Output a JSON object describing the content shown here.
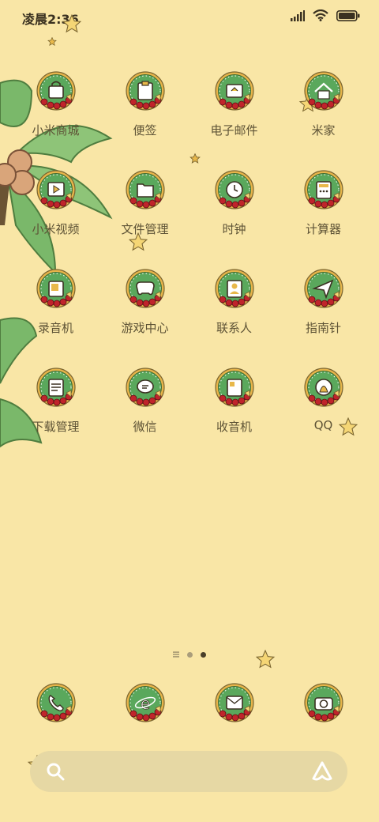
{
  "status_bar": {
    "time": "凌晨2:36",
    "signal": "signal-icon",
    "wifi": "wifi-icon",
    "battery": "battery-icon"
  },
  "apps": [
    [
      {
        "label": "小米商城",
        "icon": "shop-bag-icon"
      },
      {
        "label": "便签",
        "icon": "note-icon"
      },
      {
        "label": "电子邮件",
        "icon": "email-icon"
      },
      {
        "label": "米家",
        "icon": "home-icon"
      }
    ],
    [
      {
        "label": "小米视频",
        "icon": "video-icon"
      },
      {
        "label": "文件管理",
        "icon": "folder-icon"
      },
      {
        "label": "时钟",
        "icon": "clock-icon"
      },
      {
        "label": "计算器",
        "icon": "calculator-icon"
      }
    ],
    [
      {
        "label": "录音机",
        "icon": "recorder-icon"
      },
      {
        "label": "游戏中心",
        "icon": "gamepad-icon"
      },
      {
        "label": "联系人",
        "icon": "contacts-icon"
      },
      {
        "label": "指南针",
        "icon": "compass-icon"
      }
    ],
    [
      {
        "label": "下载管理",
        "icon": "download-icon"
      },
      {
        "label": "微信",
        "icon": "chat-icon"
      },
      {
        "label": "收音机",
        "icon": "radio-icon"
      },
      {
        "label": "QQ",
        "icon": "qq-icon"
      }
    ]
  ],
  "dock": [
    {
      "icon": "phone-icon"
    },
    {
      "icon": "browser-icon"
    },
    {
      "icon": "message-icon"
    },
    {
      "icon": "camera-icon"
    }
  ],
  "page_indicator": {
    "count": 3,
    "active": 2
  },
  "colors": {
    "background": "#f9e6a6",
    "badge_green": "#5aa85c",
    "badge_ring": "#e6b44a",
    "rose": "#c0242b"
  }
}
